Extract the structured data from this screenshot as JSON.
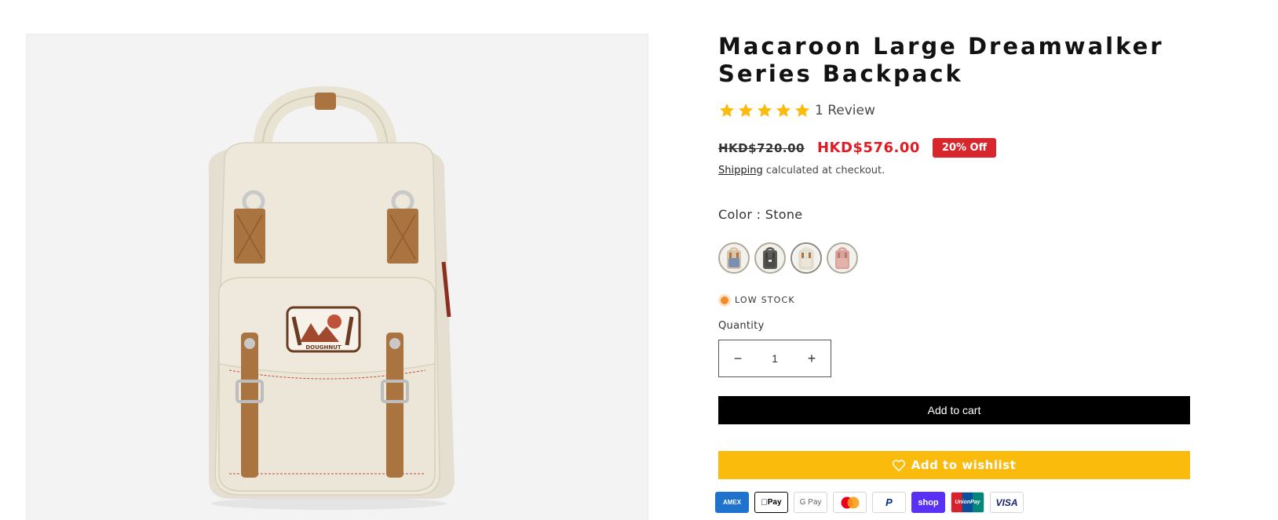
{
  "product": {
    "title": "Macaroon Large Dreamwalker Series Backpack",
    "image_alt": "Macaroon Large Dreamwalker Series Backpack in Stone",
    "brand_patch_text": "DOUGHNUT",
    "rating": {
      "stars": 5,
      "max": 5,
      "review_label": "1 Review",
      "star_color": "#fbbb0d"
    },
    "price": {
      "compare_at": "HKD$720.00",
      "sale": "HKD$576.00",
      "discount_badge": "20% Off",
      "sale_color": "#e01b24",
      "badge_color": "#d7262c"
    },
    "shipping": {
      "link_text": "Shipping",
      "rest": " calculated at checkout."
    },
    "color": {
      "label": "Color : Stone",
      "selected": "Stone",
      "swatches": [
        {
          "name": "Beige multi",
          "body": "#d9c4a8",
          "accent": "#7b8fb3"
        },
        {
          "name": "Charcoal",
          "body": "#5b5d59",
          "accent": "#3c3d3a"
        },
        {
          "name": "Stone",
          "body": "#e6e2d4",
          "accent": "#a9743f"
        },
        {
          "name": "Blush",
          "body": "#d9a39a",
          "accent": "#b87b70"
        }
      ]
    },
    "stock": {
      "text": "LOW STOCK",
      "color": "#f28c28"
    },
    "quantity": {
      "label": "Quantity",
      "value": "1",
      "minus": "−",
      "plus": "+"
    },
    "buttons": {
      "add_to_cart": "Add to cart",
      "add_to_wishlist": "Add to wishlist",
      "cart_color": "#000000",
      "wishlist_color": "#fbbb0d"
    },
    "payment_methods": [
      {
        "name": "American Express",
        "label": "AMEX",
        "icon": "amex-icon"
      },
      {
        "name": "Apple Pay",
        "label": "Pay",
        "icon": "apple-pay-icon"
      },
      {
        "name": "Google Pay",
        "label": "G Pay",
        "icon": "google-pay-icon"
      },
      {
        "name": "Mastercard",
        "label": "",
        "icon": "mastercard-icon"
      },
      {
        "name": "PayPal",
        "label": "P",
        "icon": "paypal-icon"
      },
      {
        "name": "Shop Pay",
        "label": "shop",
        "icon": "shop-pay-icon"
      },
      {
        "name": "UnionPay",
        "label": "UnionPay",
        "icon": "unionpay-icon"
      },
      {
        "name": "Visa",
        "label": "VISA",
        "icon": "visa-icon"
      }
    ]
  }
}
